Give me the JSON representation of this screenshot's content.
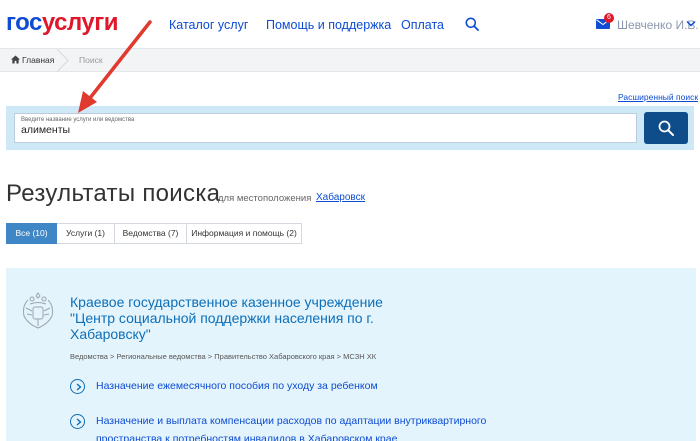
{
  "header": {
    "logo_part1": "гос",
    "logo_part2": "услуги",
    "nav": [
      "Каталог услуг",
      "Помощь и поддержка",
      "Оплата"
    ],
    "mail_count": "6",
    "user_name": "Шевченко И.В."
  },
  "breadcrumb": {
    "home": "Главная",
    "current": "Поиск"
  },
  "advanced_search": "Расширенный поиск",
  "search": {
    "hint": "Введите название услуги или ведомства",
    "value": "алименты"
  },
  "results": {
    "title": "Результаты поиска",
    "location_label": "для местоположения",
    "city": "Хабаровск"
  },
  "tabs": [
    {
      "label": "Все (10)",
      "active": true
    },
    {
      "label": "Услуги (1)",
      "active": false
    },
    {
      "label": "Ведомства (7)",
      "active": false
    },
    {
      "label": "Информация и помощь (2)",
      "active": false
    }
  ],
  "card": {
    "title": "Краевое государственное казенное учреждение \"Центр социальной поддержки населения по г. Хабаровску\"",
    "path": "Ведомства > Региональные ведомства > Правительство Хабаровского края > МСЗН ХК",
    "services": [
      "Назначение ежемесячного пособия по уходу за ребенком",
      "Назначение и выплата компенсации расходов по адаптации внутриквартирного пространства к потребностям инвалидов в Хабаровском крае"
    ]
  },
  "colors": {
    "brand_blue": "#0d4cd3",
    "brand_red": "#e0162b",
    "search_band": "#cfe8f7",
    "search_button": "#0f4c8a",
    "tab_active": "#3f86c7",
    "card_bg": "#e4f4fc",
    "annotation_arrow": "#e03a2f"
  }
}
